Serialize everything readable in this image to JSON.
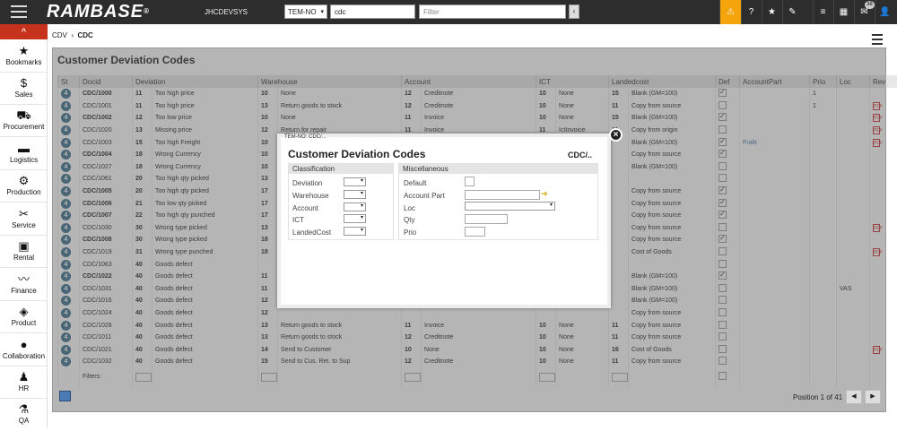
{
  "topbar": {
    "logo": "RAMBASE",
    "system": "JHCDEVSYS",
    "select": "TEM-NO",
    "search_value": "cdc",
    "filter_placeholder": "Filter",
    "notif_count": "38"
  },
  "sidebar": {
    "items": [
      {
        "label": "Bookmarks",
        "icon": "star-icon"
      },
      {
        "label": "Sales",
        "icon": "money-bag-icon"
      },
      {
        "label": "Procurement",
        "icon": "cart-icon"
      },
      {
        "label": "Logistics",
        "icon": "truck-icon"
      },
      {
        "label": "Production",
        "icon": "cogs-icon"
      },
      {
        "label": "Service",
        "icon": "wrench-icon"
      },
      {
        "label": "Rental",
        "icon": "calendar-cog-icon"
      },
      {
        "label": "Finance",
        "icon": "chart-line-icon"
      },
      {
        "label": "Product",
        "icon": "cube-icon"
      },
      {
        "label": "Collaboration",
        "icon": "chat-icon"
      },
      {
        "label": "HR",
        "icon": "person-icon"
      },
      {
        "label": "QA",
        "icon": "flask-icon"
      }
    ]
  },
  "breadcrumb": {
    "parent": "CDV",
    "current": "CDC"
  },
  "page": {
    "title": "Customer Deviation Codes"
  },
  "table": {
    "headers": [
      "St",
      "Docid",
      "Deviation",
      "",
      "Warehouse",
      "",
      "Account",
      "",
      "ICT",
      "",
      "Landedcost",
      "",
      "Def",
      "AccountPart",
      "Prio",
      "Loc",
      "Rev"
    ],
    "rows": [
      [
        "4",
        "CDC/1000",
        "11",
        "Too high price",
        "10",
        "None",
        "12",
        "Creditnote",
        "10",
        "None",
        "15",
        "Blank (GM=100)",
        "1",
        "",
        "1",
        "",
        "0"
      ],
      [
        "4",
        "CDC/1001",
        "11",
        "Too high price",
        "13",
        "Return goods to stock",
        "12",
        "Creditnote",
        "10",
        "None",
        "11",
        "Copy from source",
        "0",
        "",
        "1",
        "",
        "1"
      ],
      [
        "4",
        "CDC/1002",
        "12",
        "Too low price",
        "10",
        "None",
        "11",
        "Invoice",
        "10",
        "None",
        "15",
        "Blank (GM=100)",
        "1",
        "",
        "",
        "",
        "1"
      ],
      [
        "4",
        "CDC/1020",
        "13",
        "Missing price",
        "12",
        "Return for repair",
        "11",
        "Invoice",
        "11",
        "IctInvoice",
        "11",
        "Copy from origin",
        "0",
        "",
        "",
        "",
        "1"
      ],
      [
        "4",
        "CDC/1003",
        "15",
        "Too high Freight",
        "10",
        "",
        "",
        "",
        "",
        "",
        "",
        "Blank (GM=100)",
        "1",
        "Frakt",
        "",
        "",
        "1"
      ],
      [
        "4",
        "CDC/1004",
        "18",
        "Wrong Currency",
        "10",
        "",
        "",
        "",
        "",
        "",
        "",
        "Copy from source",
        "1",
        "",
        "",
        "",
        "0"
      ],
      [
        "4",
        "CDC/1027",
        "18",
        "Wrong Currency",
        "10",
        "",
        "",
        "",
        "",
        "",
        "",
        "Blank (GM=100)",
        "0",
        "",
        "",
        "",
        "0"
      ],
      [
        "4",
        "CDC/1061",
        "20",
        "Too high qty picked",
        "13",
        "",
        "",
        "",
        "",
        "",
        "",
        "",
        "0",
        "",
        "",
        "",
        "0"
      ],
      [
        "4",
        "CDC/1005",
        "20",
        "Too high qty picked",
        "17",
        "",
        "",
        "",
        "",
        "",
        "",
        "Copy from source",
        "1",
        "",
        "",
        "",
        "0"
      ],
      [
        "4",
        "CDC/1006",
        "21",
        "Too low qty picked",
        "17",
        "",
        "",
        "",
        "",
        "",
        "",
        "Copy from source",
        "1",
        "",
        "",
        "",
        "0"
      ],
      [
        "4",
        "CDC/1007",
        "22",
        "Too high qty punched",
        "17",
        "",
        "",
        "",
        "",
        "",
        "",
        "Copy from source",
        "1",
        "",
        "",
        "",
        "0"
      ],
      [
        "4",
        "CDC/1030",
        "30",
        "Wrong type picked",
        "13",
        "",
        "",
        "",
        "",
        "",
        "",
        "Copy from source",
        "0",
        "",
        "",
        "",
        "1"
      ],
      [
        "4",
        "CDC/1008",
        "30",
        "Wrong type picked",
        "18",
        "",
        "",
        "",
        "",
        "",
        "",
        "Copy from source",
        "1",
        "",
        "",
        "",
        "0"
      ],
      [
        "4",
        "CDC/1019",
        "31",
        "Wrong type punched",
        "18",
        "",
        "",
        "",
        "",
        "",
        "",
        "Cost of Goods",
        "0",
        "",
        "",
        "",
        "1"
      ],
      [
        "4",
        "CDC/1063",
        "40",
        "Goods defect",
        "",
        "",
        "",
        "",
        "",
        "",
        "",
        "",
        "0",
        "",
        "",
        "",
        "0"
      ],
      [
        "4",
        "CDC/1022",
        "40",
        "Goods defect",
        "11",
        "",
        "",
        "",
        "",
        "",
        "",
        "Blank (GM=100)",
        "1",
        "",
        "",
        "",
        "0"
      ],
      [
        "4",
        "CDC/1031",
        "40",
        "Goods defect",
        "11",
        "",
        "",
        "",
        "",
        "",
        "",
        "Blank (GM=100)",
        "0",
        "",
        "",
        "VAS",
        "0"
      ],
      [
        "4",
        "CDC/1016",
        "40",
        "Goods defect",
        "12",
        "",
        "",
        "",
        "",
        "",
        "",
        "Blank (GM=100)",
        "0",
        "",
        "",
        "",
        "0"
      ],
      [
        "4",
        "CDC/1024",
        "40",
        "Goods defect",
        "12",
        "",
        "",
        "",
        "",
        "",
        "",
        "Copy from source",
        "0",
        "",
        "",
        "",
        "0"
      ],
      [
        "4",
        "CDC/1028",
        "40",
        "Goods defect",
        "13",
        "Return goods to stock",
        "11",
        "Invoice",
        "10",
        "None",
        "11",
        "Copy from source",
        "0",
        "",
        "",
        "",
        "0"
      ],
      [
        "4",
        "CDC/1011",
        "40",
        "Goods defect",
        "13",
        "Return goods to stock",
        "12",
        "Creditnote",
        "10",
        "None",
        "11",
        "Copy from source",
        "0",
        "",
        "",
        "",
        "0"
      ],
      [
        "4",
        "CDC/1021",
        "40",
        "Goods defect",
        "14",
        "Send to Customer",
        "10",
        "None",
        "10",
        "None",
        "16",
        "Cost of Goods",
        "0",
        "",
        "",
        "",
        "1"
      ],
      [
        "4",
        "CDC/1032",
        "40",
        "Goods defect",
        "15",
        "Send to Cus. Ret. to Sup",
        "12",
        "Creditnote",
        "10",
        "None",
        "11",
        "Copy from source",
        "0",
        "",
        "",
        "",
        "0"
      ]
    ],
    "bold_rows": [
      "CDC/1000",
      "CDC/1002",
      "CDC/1004",
      "CDC/1005",
      "CDC/1006",
      "CDC/1007",
      "CDC/1008",
      "CDC/1022"
    ],
    "filters_label": "Filters:"
  },
  "pager": {
    "position": "Position 1 of 41"
  },
  "dialog": {
    "tag": "TEM-NO: CDC/...",
    "title": "Customer Deviation Codes",
    "code": "CDC/..",
    "classification": {
      "header": "Classification",
      "fields": [
        "Deviation",
        "Warehouse",
        "Account",
        "ICT",
        "LandedCost"
      ]
    },
    "misc": {
      "header": "Miscellaneous",
      "fields": [
        "Default",
        "Account Part",
        "Loc",
        "Qty",
        "Prio"
      ]
    }
  }
}
